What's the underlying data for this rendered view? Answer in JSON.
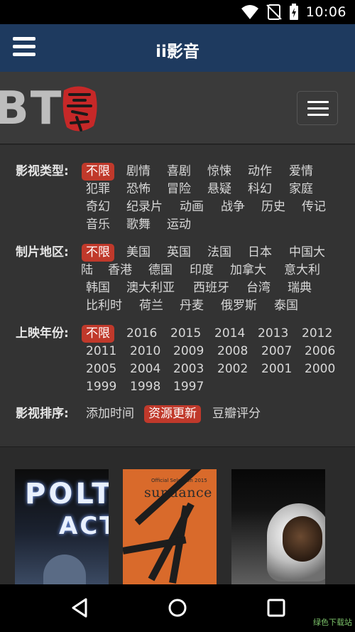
{
  "status_bar": {
    "time": "10:06"
  },
  "app_bar": {
    "title": "ii影音"
  },
  "site": {
    "logo_text": "BT"
  },
  "filters": {
    "type": {
      "label": "影视类型:",
      "items": [
        "不限",
        "剧情",
        "喜剧",
        "惊悚",
        "动作",
        "爱情",
        "犯罪",
        "恐怖",
        "冒险",
        "悬疑",
        "科幻",
        "家庭",
        "奇幻",
        "纪录片",
        "动画",
        "战争",
        "历史",
        "传记",
        "音乐",
        "歌舞",
        "运动"
      ]
    },
    "region": {
      "label": "制片地区:",
      "items": [
        "不限",
        "美国",
        "英国",
        "法国",
        "日本",
        "中国大",
        "陆",
        "香港",
        "德国",
        "印度",
        "加拿大",
        "意大利",
        "韩国",
        "澳大利亚",
        "西班牙",
        "台湾",
        "瑞典",
        "比利时",
        "荷兰",
        "丹麦",
        "俄罗斯",
        "泰国"
      ]
    },
    "year": {
      "label": "上映年份:",
      "items": [
        "不限",
        "2016",
        "2015",
        "2014",
        "2013",
        "2012",
        "2011",
        "2010",
        "2009",
        "2008",
        "2007",
        "2006",
        "2005",
        "2004",
        "2003",
        "2002",
        "2001",
        "2000",
        "1999",
        "1998",
        "1997"
      ]
    },
    "sort": {
      "label": "影视排序:",
      "items": [
        "添加时间",
        "资源更新",
        "豆瓣评分"
      ]
    }
  },
  "posters": [
    {
      "title_line1": "POLTE",
      "title_line2": "ACT"
    },
    {
      "festival": "sundance",
      "small_text": "Official Selection 2015"
    },
    {
      "title": ""
    }
  ],
  "watermark": "绿色下载站"
}
